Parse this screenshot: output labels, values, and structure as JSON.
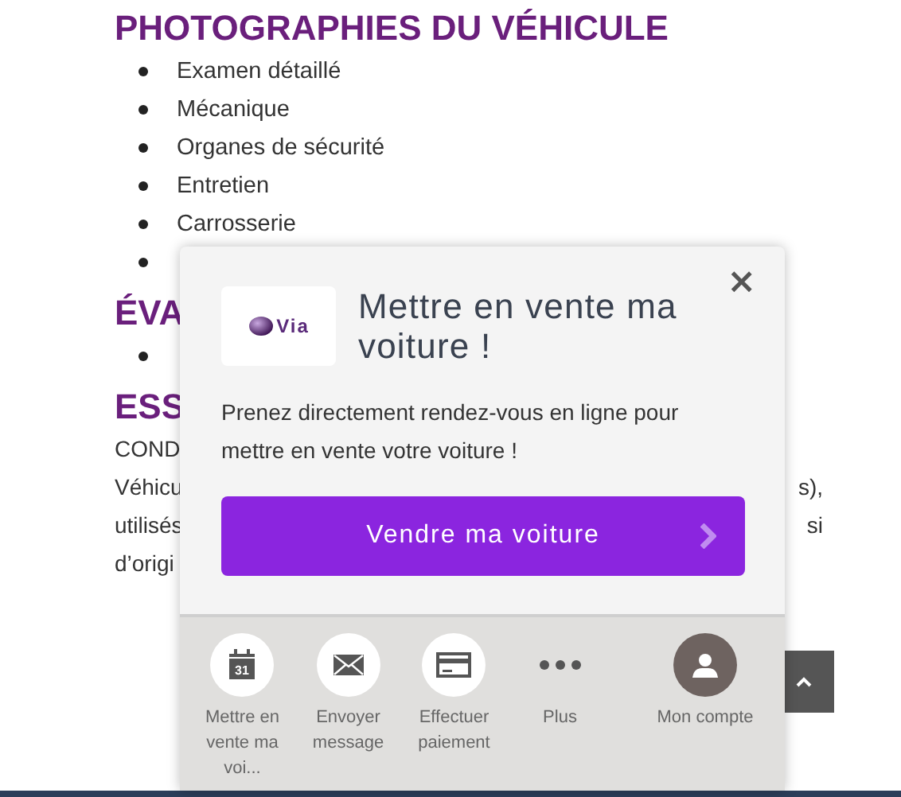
{
  "page": {
    "heading": "PHOTOGRAPHIES DU VÉHICULE",
    "items": [
      "Examen détaillé",
      "Mécanique",
      "Organes de sécurité",
      "Entretien",
      "Carrosserie"
    ],
    "heading_2": "ÉVA",
    "heading_3": "ESS",
    "lines": [
      {
        "left": "COND"
      },
      {
        "left": "Véhicu",
        "right": "s),"
      },
      {
        "left": "utilisés",
        "right": "si"
      },
      {
        "left": "d’origi"
      }
    ]
  },
  "popup": {
    "close": "×",
    "logo_text": "Via",
    "title": "Mettre en vente ma voiture !",
    "text": "Prenez directement rendez-vous en ligne pour mettre en vente votre voiture !",
    "button": "Vendre ma voiture",
    "actions": [
      {
        "kind": "calendar",
        "icon_text": "31",
        "label": "Mettre en vente ma voi..."
      },
      {
        "kind": "mail",
        "label": "Envoyer message"
      },
      {
        "kind": "card",
        "label": "Effectuer paiement"
      },
      {
        "kind": "dots",
        "label": "Plus"
      },
      {
        "kind": "user",
        "label": "Mon compte"
      }
    ]
  }
}
